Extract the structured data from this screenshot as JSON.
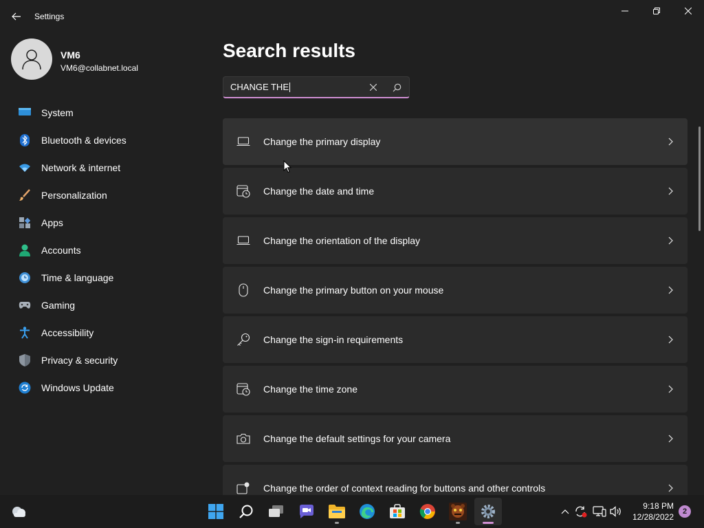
{
  "window": {
    "title": "Settings",
    "accent": "#d08fd3"
  },
  "profile": {
    "name": "VM6",
    "email": "VM6@collabnet.local"
  },
  "sidebar": {
    "items": [
      {
        "label": "System",
        "icon": "monitor-icon"
      },
      {
        "label": "Bluetooth & devices",
        "icon": "bluetooth-icon"
      },
      {
        "label": "Network & internet",
        "icon": "wifi-icon"
      },
      {
        "label": "Personalization",
        "icon": "brush-icon"
      },
      {
        "label": "Apps",
        "icon": "apps-icon"
      },
      {
        "label": "Accounts",
        "icon": "person-icon"
      },
      {
        "label": "Time & language",
        "icon": "clock-globe-icon"
      },
      {
        "label": "Gaming",
        "icon": "controller-icon"
      },
      {
        "label": "Accessibility",
        "icon": "accessibility-icon"
      },
      {
        "label": "Privacy & security",
        "icon": "shield-icon"
      },
      {
        "label": "Windows Update",
        "icon": "update-icon"
      }
    ]
  },
  "main": {
    "title": "Search results",
    "search": {
      "value": "CHANGE THE"
    },
    "results": [
      {
        "label": "Change the primary display",
        "icon": "laptop-icon"
      },
      {
        "label": "Change the date and time",
        "icon": "calendar-clock-icon"
      },
      {
        "label": "Change the orientation of the display",
        "icon": "laptop-icon"
      },
      {
        "label": "Change the primary button on your mouse",
        "icon": "mouse-icon"
      },
      {
        "label": "Change the sign-in requirements",
        "icon": "key-icon"
      },
      {
        "label": "Change the time zone",
        "icon": "calendar-clock-icon"
      },
      {
        "label": "Change the default settings for your camera",
        "icon": "camera-icon"
      },
      {
        "label": "Change the order of context reading for buttons and other controls",
        "icon": "reading-icon"
      }
    ]
  },
  "taskbar": {
    "apps": [
      {
        "name": "start",
        "icon": "windows-logo-icon"
      },
      {
        "name": "search",
        "icon": "search-icon"
      },
      {
        "name": "task view",
        "icon": "task-view-icon"
      },
      {
        "name": "chat",
        "icon": "chat-icon"
      },
      {
        "name": "file explorer",
        "icon": "folder-icon"
      },
      {
        "name": "edge",
        "icon": "edge-icon"
      },
      {
        "name": "store",
        "icon": "store-icon"
      },
      {
        "name": "chrome",
        "icon": "chrome-icon"
      },
      {
        "name": "game",
        "icon": "game-app-icon"
      },
      {
        "name": "settings",
        "icon": "gear-icon"
      }
    ],
    "time": "9:18 PM",
    "date": "12/28/2022",
    "notifications": "2"
  }
}
